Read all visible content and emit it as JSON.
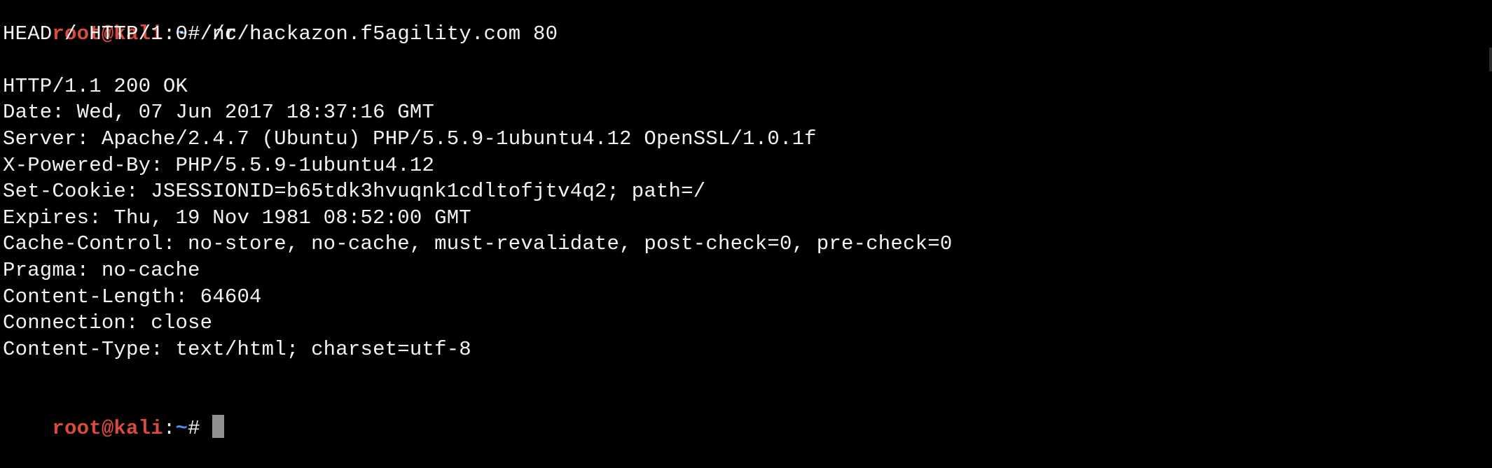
{
  "terminal": {
    "prompt": {
      "user_host": "root@kali",
      "colon": ":",
      "path": "~",
      "hash": "# "
    },
    "command": "nc hackazon.f5agility.com 80",
    "input_line": "HEAD / HTTP/1.0 //r/n",
    "blank_line": " ",
    "response_lines": [
      "HTTP/1.1 200 OK",
      "Date: Wed, 07 Jun 2017 18:37:16 GMT",
      "Server: Apache/2.4.7 (Ubuntu) PHP/5.5.9-1ubuntu4.12 OpenSSL/1.0.1f",
      "X-Powered-By: PHP/5.5.9-1ubuntu4.12",
      "Set-Cookie: JSESSIONID=b65tdk3hvuqnk1cdltofjtv4q2; path=/",
      "Expires: Thu, 19 Nov 1981 08:52:00 GMT",
      "Cache-Control: no-store, no-cache, must-revalidate, post-check=0, pre-check=0",
      "Pragma: no-cache",
      "Content-Length: 64604",
      "Connection: close",
      "Content-Type: text/html; charset=utf-8"
    ],
    "colors": {
      "background": "#000000",
      "text": "#f2f2f2",
      "prompt_user": "#d84b3d",
      "prompt_path": "#4d8ce6",
      "cursor": "#8f8f8f"
    }
  }
}
